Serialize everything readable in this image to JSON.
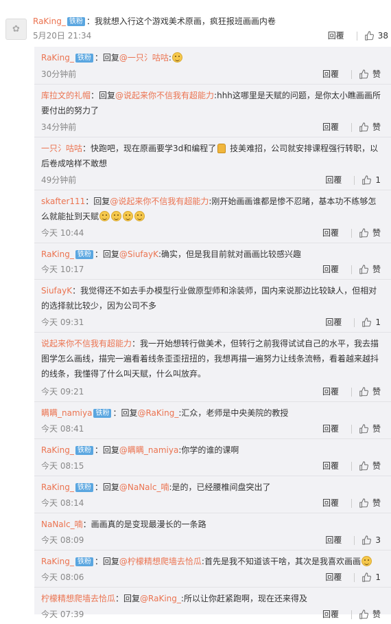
{
  "top_comment": {
    "avatar_icon": "avatar-placeholder-icon",
    "username": "RaKing_",
    "badge": "铁粉",
    "text": "：我就想入行这个游戏美术原画，疯狂报班画画内卷",
    "time": "5月20日 21:34",
    "reply_label": "回覆",
    "likes": "38"
  },
  "replies": [
    {
      "user": "RaKing_",
      "badge": "铁粉",
      "prefix": "：回复",
      "mention": "@一只氵咕咕",
      "after": ":",
      "text": "",
      "emoji": 1,
      "gift": false,
      "time": "30分钟前",
      "reply_label": "回覆",
      "likes": "赞"
    },
    {
      "user": "库拉文的礼帽",
      "badge": "",
      "prefix": "：回复",
      "mention": "@说起来你不信我有超能力",
      "after": ":",
      "text": "hhh这哪里是天赋的问题，是你太小瞧画画所要付出的努力了",
      "emoji": 0,
      "gift": false,
      "time": "34分钟前",
      "reply_label": "回覆",
      "likes": "赞"
    },
    {
      "user": "一只氵咕咕",
      "badge": "",
      "prefix": "：快跑吧，现在原画要学3d和编程了",
      "mention": "",
      "after": "",
      "text": " 技美难招，公司就安排课程强行转职，以后卷成啥样不敢想",
      "emoji": 0,
      "gift": true,
      "time": "49分钟前",
      "reply_label": "回覆",
      "likes": "1"
    },
    {
      "user": "skafter111",
      "badge": "",
      "prefix": "：回复",
      "mention": "@说起来你不信我有超能力",
      "after": ":",
      "text": "刚开始画画谁都是惨不忍睹，基本功不练够怎么就能扯到天赋",
      "emoji": 4,
      "gift": false,
      "time": "今天 10:44",
      "reply_label": "回覆",
      "likes": "赞"
    },
    {
      "user": "RaKing_",
      "badge": "铁粉",
      "prefix": "：回复",
      "mention": "@SiufayK",
      "after": ":",
      "text": "确实，但是我目前就对画画比较感兴趣",
      "emoji": 0,
      "gift": false,
      "time": "今天 10:17",
      "reply_label": "回覆",
      "likes": "赞"
    },
    {
      "user": "SiufayK",
      "badge": "",
      "prefix": "：我觉得还不如去手办模型行业做原型师和涂装师，国内来说那边比较缺人，但相对的选择就比较少，因为公司不多",
      "mention": "",
      "after": "",
      "text": "",
      "emoji": 0,
      "gift": false,
      "time": "今天 09:31",
      "reply_label": "回覆",
      "likes": "1"
    },
    {
      "user": "说起来你不信我有超能力",
      "badge": "",
      "prefix": "：我一开始想转行做美术，但转行之前我得试试自己的水平，我去描图学怎么画线，描完一遍看着线条歪歪扭扭的，我想再描一遍努力让线条流畅，看着越来越抖的线条，我懂得了什么叫天赋，什么叫放弃。",
      "mention": "",
      "after": "",
      "text": "",
      "emoji": 0,
      "gift": false,
      "time": "今天 09:21",
      "reply_label": "回覆",
      "likes": "赞"
    },
    {
      "user": "瞒瞒_namiya",
      "badge": "铁粉",
      "prefix": "：回复",
      "mention": "@RaKing_",
      "after": ":",
      "text": "汇众，老师是中央美院的教授",
      "emoji": 0,
      "gift": false,
      "time": "今天 08:41",
      "reply_label": "回覆",
      "likes": "赞"
    },
    {
      "user": "RaKing_",
      "badge": "铁粉",
      "prefix": "：回复",
      "mention": "@瞒瞒_namiya",
      "after": ":",
      "text": "你学的谁的课啊",
      "emoji": 0,
      "gift": false,
      "time": "今天 08:15",
      "reply_label": "回覆",
      "likes": "赞"
    },
    {
      "user": "RaKing_",
      "badge": "铁粉",
      "prefix": "：回复",
      "mention": "@NaNalc_喃",
      "after": ":",
      "text": "是的，已经腰椎间盘突出了",
      "emoji": 0,
      "gift": false,
      "time": "今天 08:14",
      "reply_label": "回覆",
      "likes": "赞"
    },
    {
      "user": "NaNalc_喃",
      "badge": "",
      "prefix": "：画画真的是变现最漫长的一条路",
      "mention": "",
      "after": "",
      "text": "",
      "emoji": 0,
      "gift": false,
      "time": "今天 08:09",
      "reply_label": "回覆",
      "likes": "3"
    },
    {
      "user": "RaKing_",
      "badge": "铁粉",
      "prefix": "：回复",
      "mention": "@柠檬精想爬墙去恰瓜",
      "after": ":",
      "text": "首先是我不知道该干啥，其次是我喜欢画画",
      "emoji": 1,
      "gift": false,
      "time": "今天 08:06",
      "reply_label": "回覆",
      "likes": "1"
    },
    {
      "user": "柠檬精想爬墙去恰瓜",
      "badge": "",
      "prefix": "：回复",
      "mention": "@RaKing_",
      "after": ":",
      "text": "所以让你赶紧跑啊，现在还来得及",
      "emoji": 0,
      "gift": false,
      "time": "今天 07:39",
      "reply_label": "回覆",
      "likes": "赞"
    }
  ],
  "colors": {
    "username": "#eb7350",
    "badge": "#5aa6e0",
    "reply_bg": "#f2f2f5",
    "time": "#888888"
  }
}
